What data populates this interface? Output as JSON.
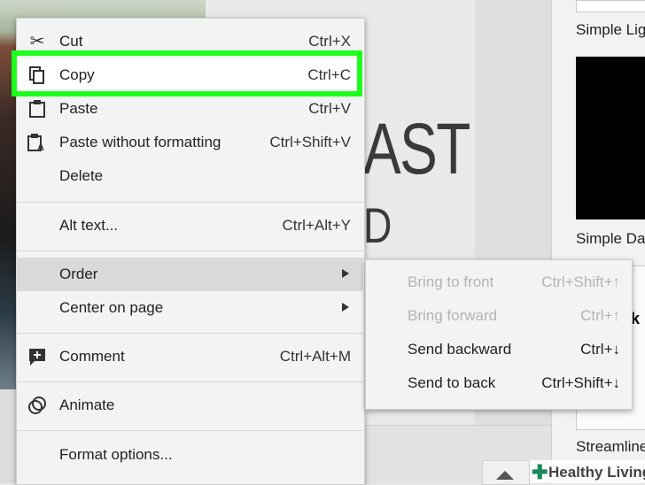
{
  "context_menu": {
    "items": [
      {
        "label": "Cut",
        "shortcut": "Ctrl+X",
        "icon": "scissors-icon"
      },
      {
        "label": "Copy",
        "shortcut": "Ctrl+C",
        "icon": "copy-icon"
      },
      {
        "label": "Paste",
        "shortcut": "Ctrl+V",
        "icon": "clipboard-icon"
      },
      {
        "label": "Paste without formatting",
        "shortcut": "Ctrl+Shift+V",
        "icon": "clipboard-text-icon"
      },
      {
        "label": "Delete",
        "shortcut": ""
      },
      {
        "label": "Alt text...",
        "shortcut": "Ctrl+Alt+Y"
      },
      {
        "label": "Order",
        "shortcut": ""
      },
      {
        "label": "Center on page",
        "shortcut": ""
      },
      {
        "label": "Comment",
        "shortcut": "Ctrl+Alt+M",
        "icon": "add-comment-icon"
      },
      {
        "label": "Animate",
        "shortcut": "",
        "icon": "animate-icon"
      },
      {
        "label": "Format options...",
        "shortcut": ""
      }
    ],
    "highlight_color": "#1dff1d"
  },
  "order_submenu": {
    "items": [
      {
        "label": "Bring to front",
        "shortcut": "Ctrl+Shift+↑",
        "enabled": false
      },
      {
        "label": "Bring forward",
        "shortcut": "Ctrl+↑",
        "enabled": false
      },
      {
        "label": "Send backward",
        "shortcut": "Ctrl+↓",
        "enabled": true
      },
      {
        "label": "Send to back",
        "shortcut": "Ctrl+Shift+↓",
        "enabled": true
      }
    ]
  },
  "slide": {
    "text_line_1": "AST",
    "text_line_2": "D"
  },
  "themes": {
    "items": [
      {
        "label": "Simple Lig"
      },
      {
        "label": "Simple Da"
      },
      {
        "label": "Streamline"
      }
    ],
    "streamline_glyph": "k"
  },
  "watermark": {
    "text": "Healthy Living"
  }
}
